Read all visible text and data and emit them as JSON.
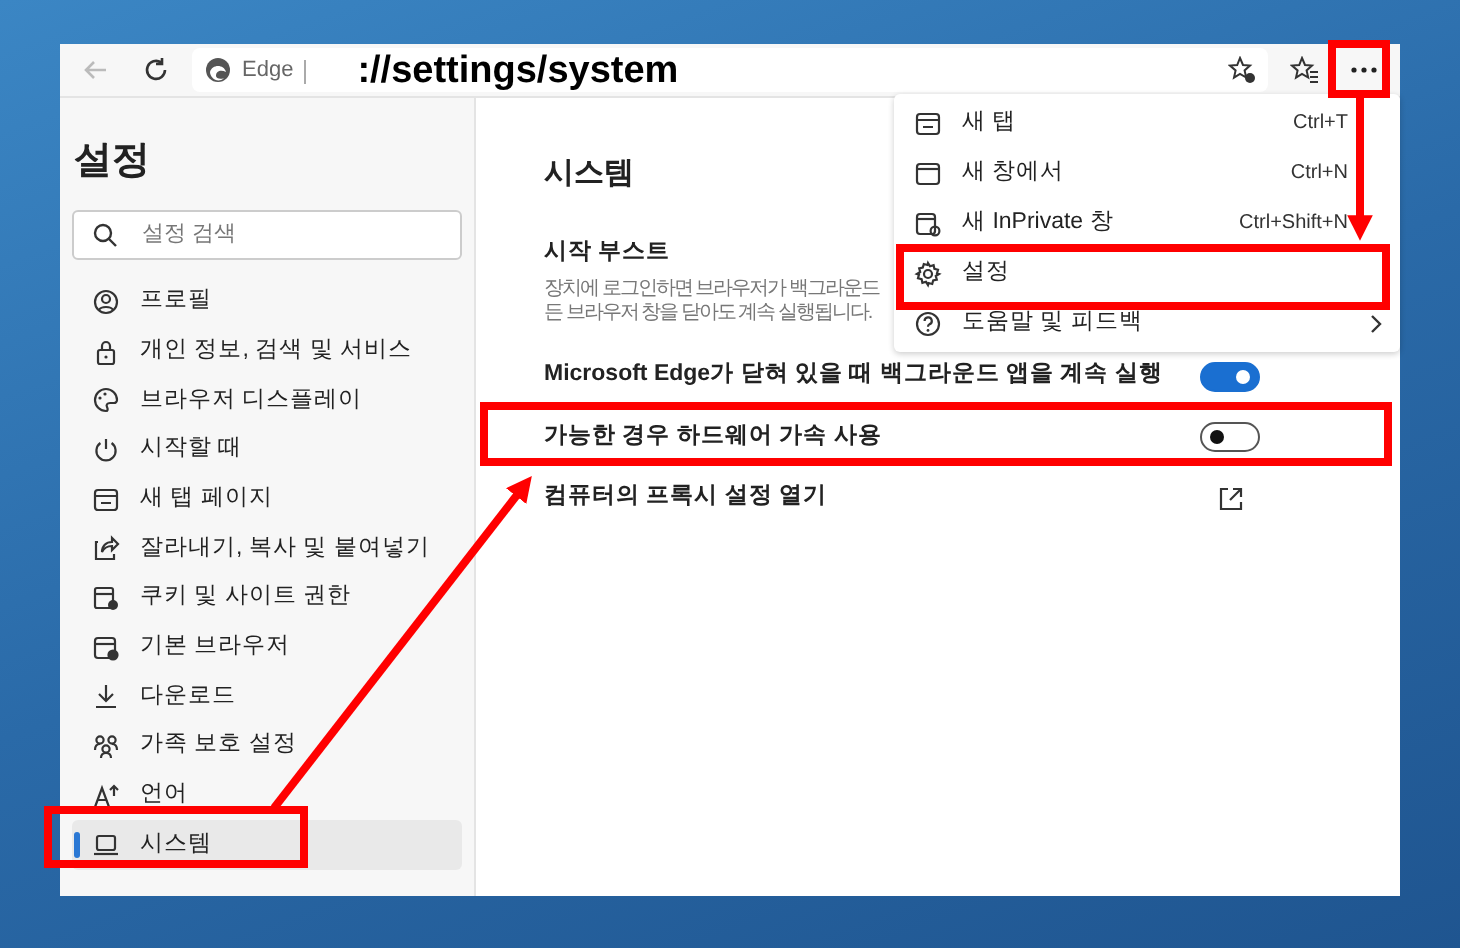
{
  "toolbar": {
    "back_disabled": true,
    "site_label": "Edge",
    "url": "://settings/system"
  },
  "sidebar": {
    "title": "설정",
    "search": {
      "placeholder": "설정 검색"
    },
    "items": [
      {
        "label": "프로필",
        "selected": false
      },
      {
        "label": "개인 정보, 검색 및 서비스",
        "selected": false
      },
      {
        "label": "브라우저 디스플레이",
        "selected": false
      },
      {
        "label": "시작할 때",
        "selected": false
      },
      {
        "label": "새 탭 페이지",
        "selected": false
      },
      {
        "label": "잘라내기, 복사 및 붙여넣기",
        "selected": false
      },
      {
        "label": "쿠키 및 사이트 권한",
        "selected": false
      },
      {
        "label": "기본 브라우저",
        "selected": false
      },
      {
        "label": "다운로드",
        "selected": false
      },
      {
        "label": "가족 보호 설정",
        "selected": false
      },
      {
        "label": "언어",
        "selected": false
      },
      {
        "label": "시스템",
        "selected": true
      }
    ]
  },
  "content": {
    "title": "시스템",
    "settings": [
      {
        "kind": "text",
        "label": "시작 부스트",
        "description": [
          "장치에 로그인하면 브라우저가 백그라운드",
          "든 브라우저 창을 닫아도 계속 실행됩니다."
        ]
      },
      {
        "kind": "toggle",
        "label": "Microsoft Edge가 닫혀 있을 때 백그라운드 앱을 계속 실행",
        "on": true
      },
      {
        "kind": "toggle",
        "label": "가능한 경우 하드웨어 가속 사용",
        "on": false
      },
      {
        "kind": "link",
        "label": "컴퓨터의 프록시 설정 열기"
      }
    ]
  },
  "menu": {
    "items": [
      {
        "label": "새 탭",
        "shortcut": "Ctrl+T",
        "submenu": false
      },
      {
        "label": "새 창에서",
        "shortcut": "Ctrl+N",
        "submenu": false
      },
      {
        "label": "새 InPrivate 창",
        "shortcut": "Ctrl+Shift+N",
        "submenu": false
      },
      {
        "label": "설정",
        "submenu": false
      },
      {
        "label": "도움말 및 피드백",
        "submenu": true
      }
    ]
  }
}
